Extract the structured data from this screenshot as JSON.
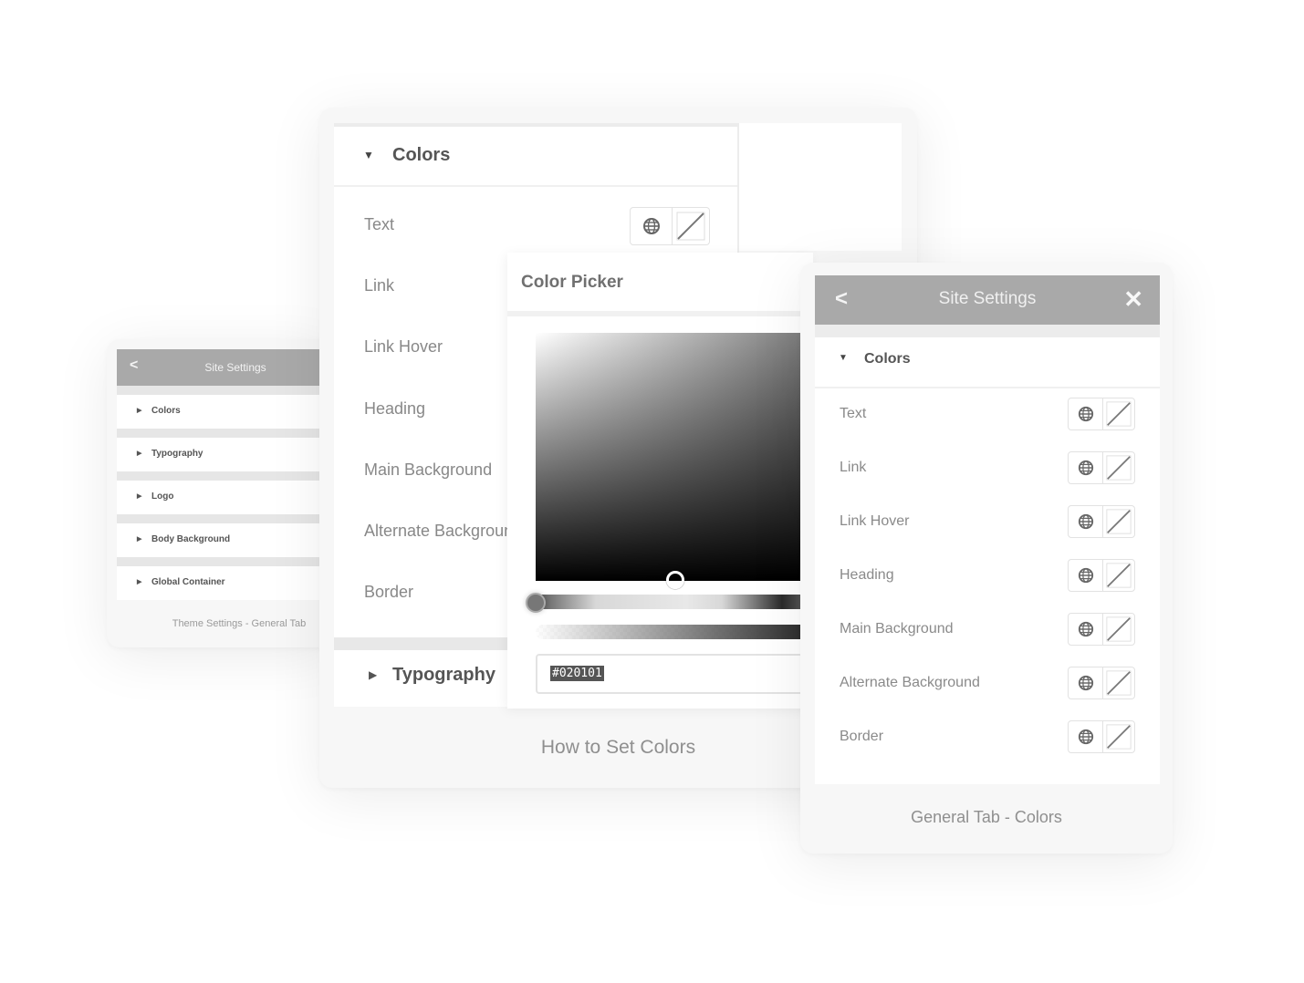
{
  "left_card": {
    "header": {
      "back_icon": "chevron-left-icon",
      "title": "Site Settings"
    },
    "items": [
      {
        "label": "Colors"
      },
      {
        "label": "Typography"
      },
      {
        "label": "Logo"
      },
      {
        "label": "Body Background"
      },
      {
        "label": "Global Container"
      }
    ],
    "caption": "Theme Settings - General Tab"
  },
  "main_card": {
    "section": {
      "title": "Colors",
      "expanded": true
    },
    "rows": [
      {
        "label": "Text"
      },
      {
        "label": "Link"
      },
      {
        "label": "Link Hover"
      },
      {
        "label": "Heading"
      },
      {
        "label": "Main Background"
      },
      {
        "label": "Alternate Background"
      },
      {
        "label": "Border"
      }
    ],
    "collapsed_section": {
      "title": "Typography",
      "expanded": false
    },
    "caption": "How to Set Colors"
  },
  "color_picker": {
    "title": "Color Picker",
    "hex_value": "#020101",
    "colors": {
      "base": "#7a7a7a"
    }
  },
  "right_card": {
    "header": {
      "back_icon": "chevron-left-icon",
      "title": "Site Settings",
      "close_icon": "close-icon"
    },
    "section": {
      "title": "Colors",
      "expanded": true
    },
    "rows": [
      {
        "label": "Text"
      },
      {
        "label": "Link"
      },
      {
        "label": "Link Hover"
      },
      {
        "label": "Heading"
      },
      {
        "label": "Main Background"
      },
      {
        "label": "Alternate Background"
      },
      {
        "label": "Border"
      }
    ],
    "caption": "General Tab - Colors"
  },
  "icons": {
    "caret_down": "▼",
    "caret_right": "▶",
    "back": "<",
    "close": "✕",
    "globe": "globe-icon",
    "no_color": "no-color-swatch-icon"
  },
  "colors": {
    "header_bg": "#a9a9a9",
    "panel_bg": "#ffffff",
    "card_bg": "#f7f7f7",
    "separator": "#e6e6e6"
  }
}
